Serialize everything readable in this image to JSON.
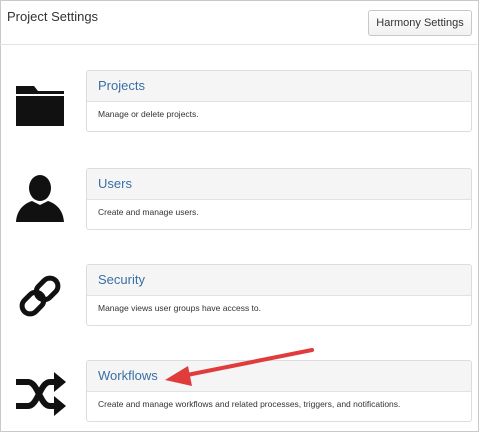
{
  "header": {
    "title": "Project Settings",
    "harmony_button_label": "Harmony Settings"
  },
  "sections": [
    {
      "title": "Projects",
      "description": "Manage or delete projects.",
      "icon": "folder-icon"
    },
    {
      "title": "Users",
      "description": "Create and manage users.",
      "icon": "user-icon"
    },
    {
      "title": "Security",
      "description": "Manage views user groups have access to.",
      "icon": "link-icon"
    },
    {
      "title": "Workflows",
      "description": "Create and manage workflows and related processes, triggers, and notifications.",
      "icon": "shuffle-icon"
    }
  ],
  "annotation": {
    "arrow_color": "#e03c3c",
    "points_to": "Workflows"
  },
  "colors": {
    "link": "#3a6fa6",
    "card_header_bg": "#f5f5f5"
  }
}
